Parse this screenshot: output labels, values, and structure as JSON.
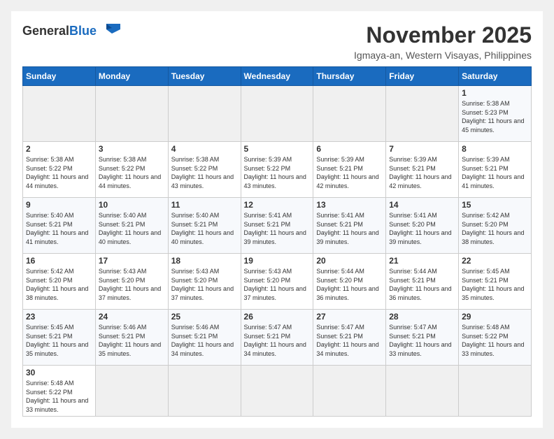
{
  "logo": {
    "general": "General",
    "blue": "Blue"
  },
  "header": {
    "month": "November 2025",
    "location": "Igmaya-an, Western Visayas, Philippines"
  },
  "days_of_week": [
    "Sunday",
    "Monday",
    "Tuesday",
    "Wednesday",
    "Thursday",
    "Friday",
    "Saturday"
  ],
  "weeks": [
    {
      "days": [
        {
          "num": "",
          "info": ""
        },
        {
          "num": "",
          "info": ""
        },
        {
          "num": "",
          "info": ""
        },
        {
          "num": "",
          "info": ""
        },
        {
          "num": "",
          "info": ""
        },
        {
          "num": "",
          "info": ""
        },
        {
          "num": "1",
          "sunrise": "5:38 AM",
          "sunset": "5:23 PM",
          "daylight": "11 hours and 45 minutes."
        }
      ]
    },
    {
      "days": [
        {
          "num": "2",
          "sunrise": "5:38 AM",
          "sunset": "5:22 PM",
          "daylight": "11 hours and 44 minutes."
        },
        {
          "num": "3",
          "sunrise": "5:38 AM",
          "sunset": "5:22 PM",
          "daylight": "11 hours and 44 minutes."
        },
        {
          "num": "4",
          "sunrise": "5:38 AM",
          "sunset": "5:22 PM",
          "daylight": "11 hours and 43 minutes."
        },
        {
          "num": "5",
          "sunrise": "5:39 AM",
          "sunset": "5:22 PM",
          "daylight": "11 hours and 43 minutes."
        },
        {
          "num": "6",
          "sunrise": "5:39 AM",
          "sunset": "5:21 PM",
          "daylight": "11 hours and 42 minutes."
        },
        {
          "num": "7",
          "sunrise": "5:39 AM",
          "sunset": "5:21 PM",
          "daylight": "11 hours and 42 minutes."
        },
        {
          "num": "8",
          "sunrise": "5:39 AM",
          "sunset": "5:21 PM",
          "daylight": "11 hours and 41 minutes."
        }
      ]
    },
    {
      "days": [
        {
          "num": "9",
          "sunrise": "5:40 AM",
          "sunset": "5:21 PM",
          "daylight": "11 hours and 41 minutes."
        },
        {
          "num": "10",
          "sunrise": "5:40 AM",
          "sunset": "5:21 PM",
          "daylight": "11 hours and 40 minutes."
        },
        {
          "num": "11",
          "sunrise": "5:40 AM",
          "sunset": "5:21 PM",
          "daylight": "11 hours and 40 minutes."
        },
        {
          "num": "12",
          "sunrise": "5:41 AM",
          "sunset": "5:21 PM",
          "daylight": "11 hours and 39 minutes."
        },
        {
          "num": "13",
          "sunrise": "5:41 AM",
          "sunset": "5:21 PM",
          "daylight": "11 hours and 39 minutes."
        },
        {
          "num": "14",
          "sunrise": "5:41 AM",
          "sunset": "5:20 PM",
          "daylight": "11 hours and 39 minutes."
        },
        {
          "num": "15",
          "sunrise": "5:42 AM",
          "sunset": "5:20 PM",
          "daylight": "11 hours and 38 minutes."
        }
      ]
    },
    {
      "days": [
        {
          "num": "16",
          "sunrise": "5:42 AM",
          "sunset": "5:20 PM",
          "daylight": "11 hours and 38 minutes."
        },
        {
          "num": "17",
          "sunrise": "5:43 AM",
          "sunset": "5:20 PM",
          "daylight": "11 hours and 37 minutes."
        },
        {
          "num": "18",
          "sunrise": "5:43 AM",
          "sunset": "5:20 PM",
          "daylight": "11 hours and 37 minutes."
        },
        {
          "num": "19",
          "sunrise": "5:43 AM",
          "sunset": "5:20 PM",
          "daylight": "11 hours and 37 minutes."
        },
        {
          "num": "20",
          "sunrise": "5:44 AM",
          "sunset": "5:20 PM",
          "daylight": "11 hours and 36 minutes."
        },
        {
          "num": "21",
          "sunrise": "5:44 AM",
          "sunset": "5:21 PM",
          "daylight": "11 hours and 36 minutes."
        },
        {
          "num": "22",
          "sunrise": "5:45 AM",
          "sunset": "5:21 PM",
          "daylight": "11 hours and 35 minutes."
        }
      ]
    },
    {
      "days": [
        {
          "num": "23",
          "sunrise": "5:45 AM",
          "sunset": "5:21 PM",
          "daylight": "11 hours and 35 minutes."
        },
        {
          "num": "24",
          "sunrise": "5:46 AM",
          "sunset": "5:21 PM",
          "daylight": "11 hours and 35 minutes."
        },
        {
          "num": "25",
          "sunrise": "5:46 AM",
          "sunset": "5:21 PM",
          "daylight": "11 hours and 34 minutes."
        },
        {
          "num": "26",
          "sunrise": "5:47 AM",
          "sunset": "5:21 PM",
          "daylight": "11 hours and 34 minutes."
        },
        {
          "num": "27",
          "sunrise": "5:47 AM",
          "sunset": "5:21 PM",
          "daylight": "11 hours and 34 minutes."
        },
        {
          "num": "28",
          "sunrise": "5:47 AM",
          "sunset": "5:21 PM",
          "daylight": "11 hours and 33 minutes."
        },
        {
          "num": "29",
          "sunrise": "5:48 AM",
          "sunset": "5:22 PM",
          "daylight": "11 hours and 33 minutes."
        }
      ]
    },
    {
      "days": [
        {
          "num": "30",
          "sunrise": "5:48 AM",
          "sunset": "5:22 PM",
          "daylight": "11 hours and 33 minutes."
        },
        {
          "num": "",
          "info": ""
        },
        {
          "num": "",
          "info": ""
        },
        {
          "num": "",
          "info": ""
        },
        {
          "num": "",
          "info": ""
        },
        {
          "num": "",
          "info": ""
        },
        {
          "num": "",
          "info": ""
        }
      ]
    }
  ]
}
